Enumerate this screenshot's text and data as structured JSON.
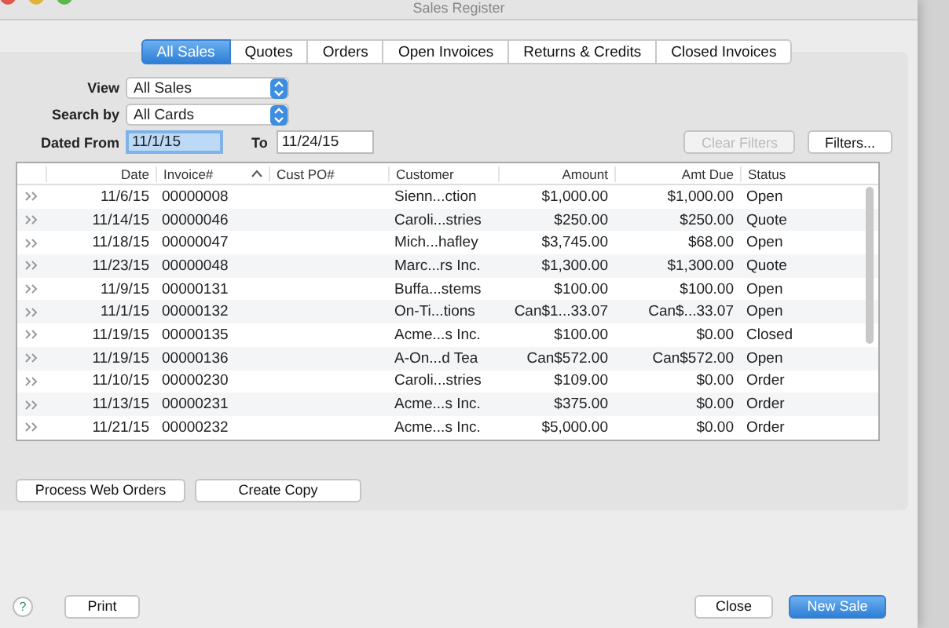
{
  "window": {
    "title": "Sales Register"
  },
  "tabs": [
    {
      "label": "All Sales",
      "selected": true
    },
    {
      "label": "Quotes",
      "selected": false
    },
    {
      "label": "Orders",
      "selected": false
    },
    {
      "label": "Open Invoices",
      "selected": false
    },
    {
      "label": "Returns & Credits",
      "selected": false
    },
    {
      "label": "Closed Invoices",
      "selected": false
    }
  ],
  "filters": {
    "view": {
      "label": "View",
      "value": "All Sales"
    },
    "search_by": {
      "label": "Search by",
      "value": "All Cards"
    },
    "dated_from": {
      "label": "Dated From",
      "value": "11/1/15",
      "focused": true
    },
    "to": {
      "label": "To",
      "value": "11/24/15",
      "focused": false
    },
    "clear_filters": {
      "label": "Clear Filters",
      "disabled": true
    },
    "filters_button": {
      "label": "Filters...",
      "disabled": false
    }
  },
  "table": {
    "columns": [
      "Date",
      "Invoice#",
      "Cust PO#",
      "Customer",
      "Amount",
      "Amt Due",
      "Status"
    ],
    "rows": [
      [
        "11/6/15",
        "00000008",
        "",
        "Sienn...ction",
        "$1,000.00",
        "$1,000.00",
        "Open"
      ],
      [
        "11/14/15",
        "00000046",
        "",
        "Caroli...stries",
        "$250.00",
        "$250.00",
        "Quote"
      ],
      [
        "11/18/15",
        "00000047",
        "",
        "Mich...hafley",
        "$3,745.00",
        "$68.00",
        "Open"
      ],
      [
        "11/23/15",
        "00000048",
        "",
        "Marc...rs Inc.",
        "$1,300.00",
        "$1,300.00",
        "Quote"
      ],
      [
        "11/9/15",
        "00000131",
        "",
        "Buffa...stems",
        "$100.00",
        "$100.00",
        "Open"
      ],
      [
        "11/1/15",
        "00000132",
        "",
        "On-Ti...tions",
        "Can$1...33.07",
        "Can$...33.07",
        "Open"
      ],
      [
        "11/19/15",
        "00000135",
        "",
        "Acme...s Inc.",
        "$100.00",
        "$0.00",
        "Closed"
      ],
      [
        "11/19/15",
        "00000136",
        "",
        "A-On...d Tea",
        "Can$572.00",
        "Can$572.00",
        "Open"
      ],
      [
        "11/10/15",
        "00000230",
        "",
        "Caroli...stries",
        "$109.00",
        "$0.00",
        "Order"
      ],
      [
        "11/13/15",
        "00000231",
        "",
        "Acme...s Inc.",
        "$375.00",
        "$0.00",
        "Order"
      ],
      [
        "11/21/15",
        "00000232",
        "",
        "Acme...s Inc.",
        "$5,000.00",
        "$0.00",
        "Order"
      ]
    ]
  },
  "panel_buttons": [
    "Process Web Orders",
    "Create Copy"
  ],
  "footer": {
    "help": "?",
    "print": "Print",
    "close": "Close",
    "primary": "New Sale"
  }
}
